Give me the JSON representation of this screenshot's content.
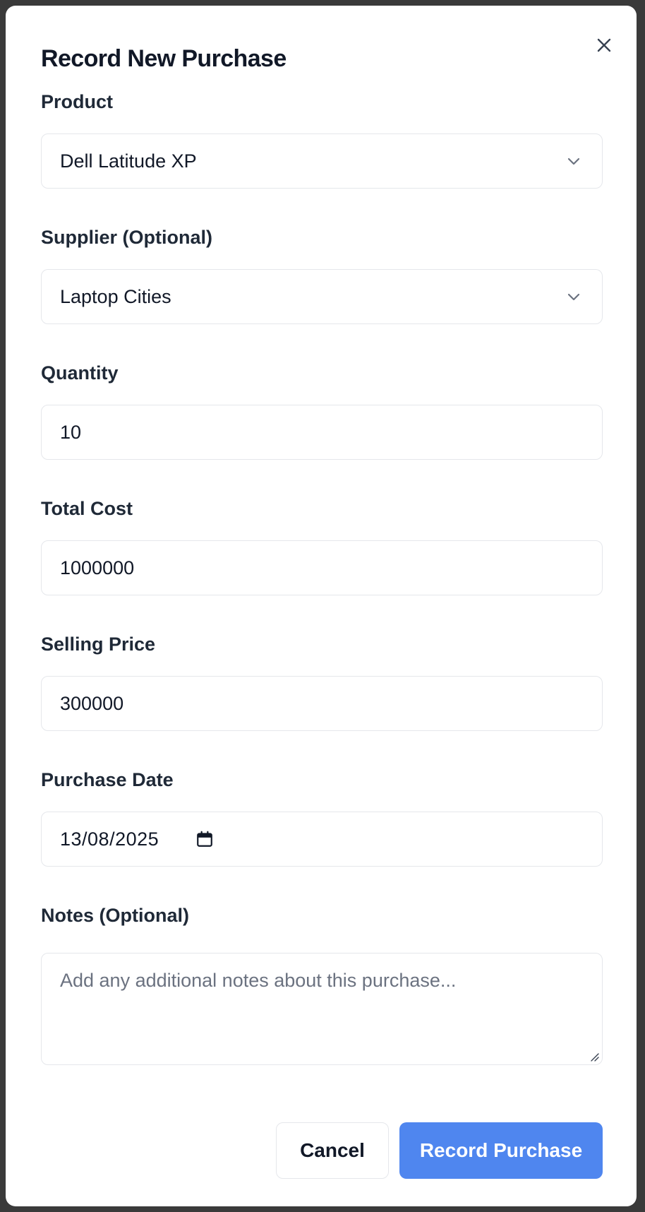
{
  "dialog": {
    "title": "Record New Purchase",
    "close_icon": "close-icon"
  },
  "form": {
    "product": {
      "label": "Product",
      "value": "Dell Latitude XP",
      "icon": "chevron-down-icon"
    },
    "supplier": {
      "label": "Supplier (Optional)",
      "value": "Laptop Cities",
      "icon": "chevron-down-icon"
    },
    "quantity": {
      "label": "Quantity",
      "value": "10"
    },
    "total_cost": {
      "label": "Total Cost",
      "value": "1000000"
    },
    "selling_price": {
      "label": "Selling Price",
      "value": "300000"
    },
    "purchase_date": {
      "label": "Purchase Date",
      "value": "13/08/2025",
      "icon": "calendar-icon"
    },
    "notes": {
      "label": "Notes (Optional)",
      "placeholder": "Add any additional notes about this purchase..."
    }
  },
  "actions": {
    "cancel_label": "Cancel",
    "submit_label": "Record Purchase"
  },
  "colors": {
    "primary": "#4f86ef",
    "border": "#e5e7eb",
    "text": "#111827",
    "placeholder": "#6b7280"
  }
}
